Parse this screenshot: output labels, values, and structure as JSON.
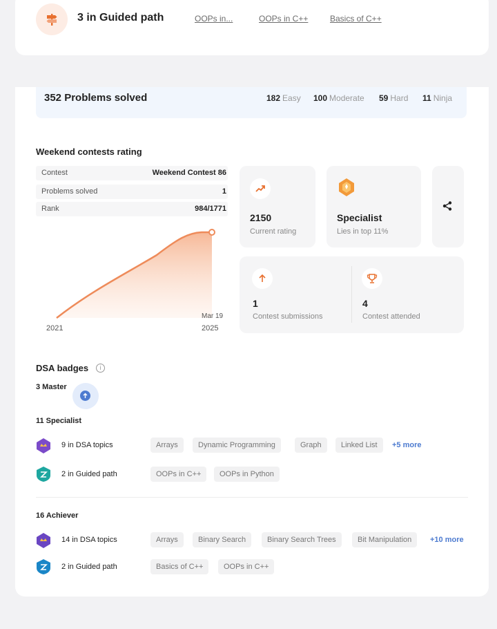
{
  "guided": {
    "title": "3 in Guided path",
    "links": [
      "OOPs in...",
      "OOPs in C++",
      "Basics of C++"
    ]
  },
  "solved": {
    "title": "352 Problems solved",
    "difficulties": [
      {
        "count": "182",
        "label": "Easy"
      },
      {
        "count": "100",
        "label": "Moderate"
      },
      {
        "count": "59",
        "label": "Hard"
      },
      {
        "count": "11",
        "label": "Ninja"
      }
    ]
  },
  "contest": {
    "title": "Weekend contests rating",
    "rows": [
      {
        "key": "Contest",
        "value": "Weekend Contest 86"
      },
      {
        "key": "Problems solved",
        "value": "1"
      },
      {
        "key": "Rank",
        "value": "984/1771"
      }
    ],
    "rating": {
      "value": "2150",
      "label": "Current rating"
    },
    "level": {
      "value": "Specialist",
      "label": "Lies in top 11%"
    },
    "submissions": {
      "value": "1",
      "label": "Contest submissions"
    },
    "attended": {
      "value": "4",
      "label": "Contest attended"
    }
  },
  "chart_data": {
    "type": "area",
    "x_start_label": "2021",
    "x_end_label": "2025",
    "point_label": "Mar 19",
    "line_color": "#ee8b5a"
  },
  "badges": {
    "title": "DSA badges",
    "master": "3 Master",
    "specialist": {
      "title": "11 Specialist",
      "dsa": {
        "label": "9 in DSA topics",
        "chips": [
          "Arrays",
          "Dynamic Programming",
          "Graph",
          "Linked List"
        ],
        "more": "+5 more"
      },
      "guided": {
        "label": "2 in Guided path",
        "chips": [
          "OOPs in C++",
          "OOPs in Python"
        ]
      }
    },
    "achiever": {
      "title": "16 Achiever",
      "dsa": {
        "label": "14 in DSA topics",
        "chips": [
          "Arrays",
          "Binary Search",
          "Binary Search Trees",
          "Bit Manipulation"
        ],
        "more": "+10 more"
      },
      "guided": {
        "label": "2 in Guided path",
        "chips": [
          "Basics of C++",
          "OOPs in C++"
        ]
      }
    }
  },
  "colors": {
    "accent": "#ee8b5a",
    "link": "#4d7bd0",
    "banner": "#f1f6fd"
  }
}
